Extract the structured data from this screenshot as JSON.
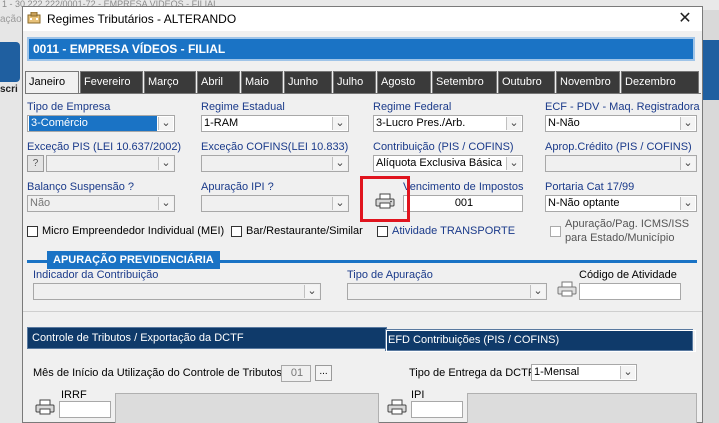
{
  "background": {
    "title_text": "1 - 30.222.222/0001-72 - EMPRESA VÍDEOS - FILIAL",
    "left_text": "ação /",
    "left_caption": "scri"
  },
  "window": {
    "title": "Regimes Tributários   -   ALTERANDO",
    "close_symbol": "✕"
  },
  "company": {
    "name": "0011 - EMPRESA VÍDEOS - FILIAL"
  },
  "months": [
    "Janeiro",
    "Fevereiro",
    "Março",
    "Abril",
    "Maio",
    "Junho",
    "Julho",
    "Agosto",
    "Setembro",
    "Outubro",
    "Novembro",
    "Dezembro"
  ],
  "active_month": "Janeiro",
  "form": {
    "tipo_empresa": {
      "label": "Tipo de Empresa",
      "value": "3-Comércio"
    },
    "regime_estadual": {
      "label": "Regime Estadual",
      "value": "1-RAM"
    },
    "regime_federal": {
      "label": "Regime Federal",
      "value": "3-Lucro Pres./Arb."
    },
    "ecf": {
      "label": "ECF - PDV - Maq. Registradora",
      "value": "N-Não"
    },
    "excecao_pis": {
      "label": "Exceção PIS (LEI 10.637/2002)",
      "value": "",
      "button": "?"
    },
    "excecao_cofins": {
      "label": "Exceção COFINS(LEI 10.833)",
      "value": ""
    },
    "contribuicao": {
      "label": "Contribuição (PIS / COFINS)",
      "value": "Alíquota Exclusiva Básica"
    },
    "aprop_credito": {
      "label": "Aprop.Crédito (PIS / COFINS)",
      "value": ""
    },
    "balanco": {
      "label": "Balanço Suspensão ?",
      "value": "Não"
    },
    "apuracao_ipi": {
      "label": "Apuração IPI ?",
      "value": ""
    },
    "vencimento": {
      "label": "Vencimento de Impostos",
      "value": "001"
    },
    "portaria": {
      "label": "Portaria Cat 17/99",
      "value": "N-Não optante"
    },
    "mei": {
      "label": "Micro Empreendedor Individual (MEI)"
    },
    "bar": {
      "label": "Bar/Restaurante/Similar"
    },
    "transporte": {
      "label": "Atividade TRANSPORTE"
    },
    "apuracao_icms_1": "Apuração/Pag. ICMS/ISS",
    "apuracao_icms_2": "para Estado/Município"
  },
  "previdenciaria": {
    "section_title": "APURAÇÃO PREVIDENCIÁRIA",
    "indicador": {
      "label": "Indicador da Contribuição",
      "value": ""
    },
    "tipo_apuracao": {
      "label": "Tipo de Apuração",
      "value": ""
    },
    "codigo_atividade": {
      "label": "Código de Atividade",
      "value": ""
    }
  },
  "bottom": {
    "tab_dctf": "Controle de Tributos / Exportação da DCTF",
    "tab_efd": "EFD Contribuições (PIS / COFINS)",
    "mes_inicio_label": "Mês de Início da Utilização do Controle de Tributos:",
    "mes_inicio_value": "01",
    "dots": "...",
    "tipo_entrega_label": "Tipo de Entrega da DCTF:",
    "tipo_entrega_value": "1-Mensal",
    "irrf_label": "IRRF",
    "ipi_label": "IPI"
  },
  "colors": {
    "accent": "#1a73c5",
    "highlight": "#e0141e"
  }
}
